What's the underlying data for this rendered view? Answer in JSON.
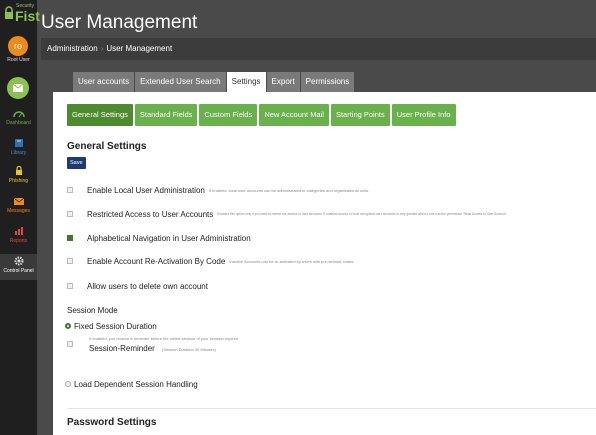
{
  "brand": {
    "top": "Security",
    "name": "Fist"
  },
  "user": {
    "initials": "ro",
    "name": "Root User"
  },
  "nav": [
    {
      "label": "Dashboard",
      "icon": "dashboard-icon"
    },
    {
      "label": "Library",
      "icon": "library-icon"
    },
    {
      "label": "Phishing",
      "icon": "phishing-icon"
    },
    {
      "label": "Messages",
      "icon": "envelope-icon"
    },
    {
      "label": "Reports",
      "icon": "chart-icon"
    },
    {
      "label": "Control Panel",
      "icon": "gear-icon"
    }
  ],
  "page_title": "User Management",
  "breadcrumb": [
    "Administration",
    "User Management"
  ],
  "tabs": [
    "User accounts",
    "Extended User Search",
    "Settings",
    "Export",
    "Permissions"
  ],
  "active_tab": "Settings",
  "subtabs": [
    "General Settings",
    "Standard Fields",
    "Custom Fields",
    "New Account Mail",
    "Starting Points",
    "User Profile Info"
  ],
  "section_title": "General Settings",
  "save_label": "Save",
  "settings": [
    {
      "label": "Enable Local User Administration",
      "desc": "If enabled, local user accounts can be administrated in categories and organizational units.",
      "checked": false
    },
    {
      "label": "Restricted Access to User Accounts",
      "desc": "Enabled this option only if you want to restrict the access to user accounts. If enabled access to local and global user accounts is only granted when a role has the permission 'Read Access to User Account'.",
      "checked": false
    },
    {
      "label": "Alphabetical Navigation in User Administration",
      "desc": "",
      "checked": true
    },
    {
      "label": "Enable Account Re-Activation By Code",
      "desc": "Inactive Accounts can be re-activated by users with pre-defined codes.",
      "checked": false
    },
    {
      "label": "Allow users to delete own account",
      "desc": "",
      "checked": false
    }
  ],
  "session": {
    "mode_label": "Session Mode",
    "fixed_label": "Fixed Session Duration",
    "reminder_desc": "If enabled, you receive a reminder before the online-session of your browser expires.",
    "reminder_label": "Session-Reminder",
    "reminder_note": "(Session Duration 30 Minutes)",
    "dependent_label": "Load Dependent Session Handling"
  },
  "password_title": "Password Settings",
  "colors": {
    "accent_green": "#6ab04c",
    "save_blue": "#1d3b73",
    "avatar_orange": "#f0881a"
  }
}
